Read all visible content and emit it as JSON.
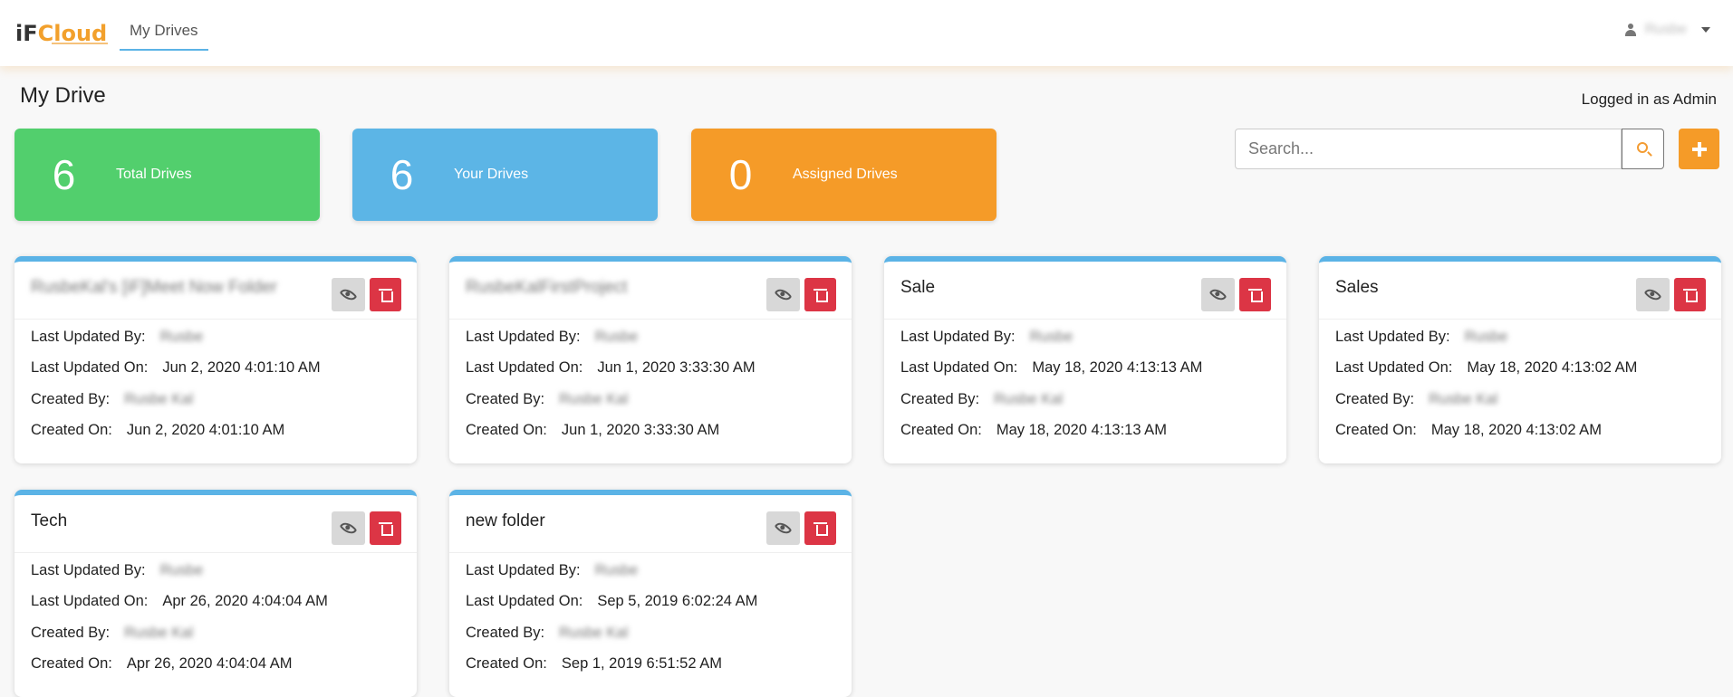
{
  "header": {
    "logo_part1": "iF",
    "logo_part2": "Cloud",
    "nav_tab": "My Drives",
    "user_name": "Rusbe"
  },
  "page": {
    "title": "My Drive",
    "logged_in": "Logged in as Admin"
  },
  "stats": [
    {
      "value": "6",
      "label": "Total Drives",
      "color": "#52cf6d"
    },
    {
      "value": "6",
      "label": "Your Drives",
      "color": "#5cb5e6"
    },
    {
      "value": "0",
      "label": "Assigned Drives",
      "color": "#f59b28"
    }
  ],
  "search": {
    "placeholder": "Search..."
  },
  "labels": {
    "updated_by": "Last Updated By:",
    "updated_on": "Last Updated On:",
    "created_by": "Created By:",
    "created_on": "Created On:"
  },
  "drives": [
    {
      "title": "RusbeKal's [iF]Meet Now Folder",
      "updated_by": "Rusbe",
      "updated_on": "Jun 2, 2020 4:01:10 AM",
      "created_by": "Rusbe Kal",
      "created_on": "Jun 2, 2020 4:01:10 AM"
    },
    {
      "title": "RusbeKalFirstProject",
      "updated_by": "Rusbe",
      "updated_on": "Jun 1, 2020 3:33:30 AM",
      "created_by": "Rusbe Kal",
      "created_on": "Jun 1, 2020 3:33:30 AM"
    },
    {
      "title": "Sale",
      "updated_by": "Rusbe",
      "updated_on": "May 18, 2020 4:13:13 AM",
      "created_by": "Rusbe Kal",
      "created_on": "May 18, 2020 4:13:13 AM"
    },
    {
      "title": "Sales",
      "updated_by": "Rusbe",
      "updated_on": "May 18, 2020 4:13:02 AM",
      "created_by": "Rusbe Kal",
      "created_on": "May 18, 2020 4:13:02 AM"
    },
    {
      "title": "Tech",
      "updated_by": "Rusbe",
      "updated_on": "Apr 26, 2020 4:04:04 AM",
      "created_by": "Rusbe Kal",
      "created_on": "Apr 26, 2020 4:04:04 AM"
    },
    {
      "title": "new folder",
      "updated_by": "Rusbe",
      "updated_on": "Sep 5, 2019 6:02:24 AM",
      "created_by": "Rusbe Kal",
      "created_on": "Sep 1, 2019 6:51:52 AM"
    }
  ]
}
